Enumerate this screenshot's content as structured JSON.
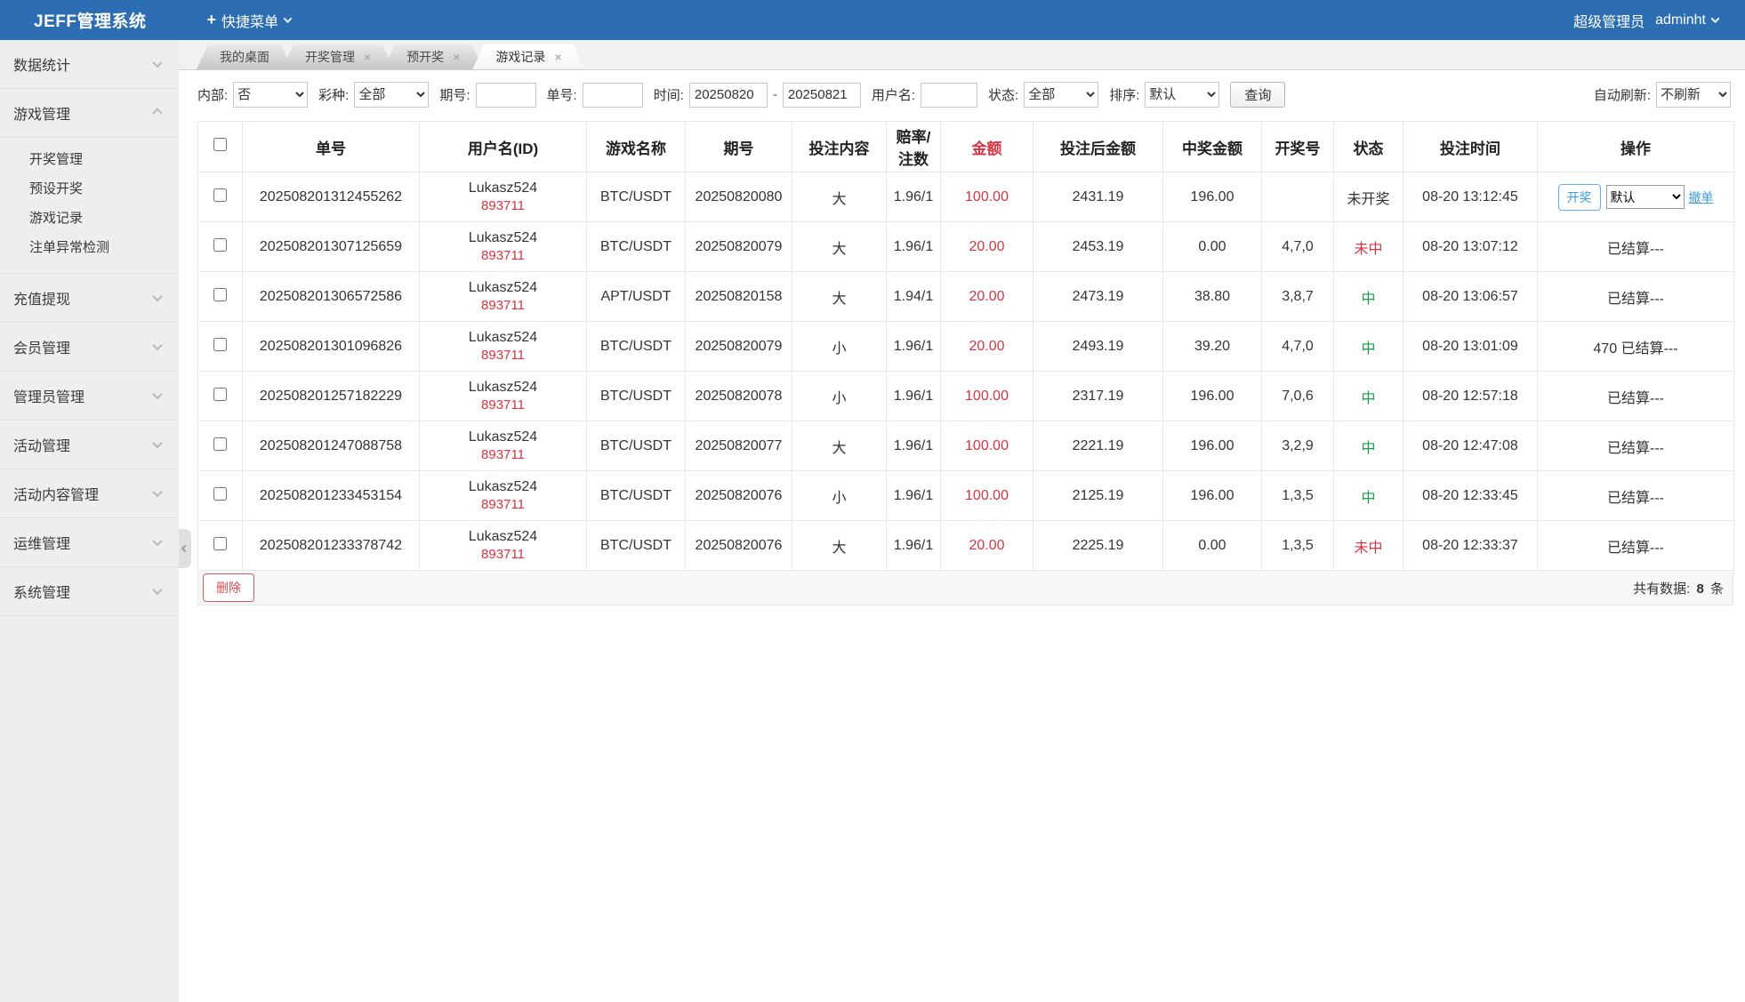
{
  "topbar": {
    "brand": "JEFF管理系统",
    "plus_icon": "+",
    "quick_menu": "快捷菜单",
    "role": "超级管理员",
    "username": "adminht"
  },
  "sidebar": {
    "groups": [
      {
        "label": "数据统计"
      },
      {
        "label": "游戏管理",
        "children": [
          "开奖管理",
          "预设开奖",
          "游戏记录",
          "注单异常检测"
        ]
      },
      {
        "label": "充值提现"
      },
      {
        "label": "会员管理"
      },
      {
        "label": "管理员管理"
      },
      {
        "label": "活动管理"
      },
      {
        "label": "活动内容管理"
      },
      {
        "label": "运维管理"
      },
      {
        "label": "系统管理"
      }
    ]
  },
  "tabs": [
    {
      "label": "我的桌面"
    },
    {
      "label": "开奖管理"
    },
    {
      "label": "预开奖"
    },
    {
      "label": "游戏记录"
    }
  ],
  "filters": {
    "internal_label": "内部:",
    "internal_value": "否",
    "lottery_label": "彩种:",
    "lottery_value": "全部",
    "issue_label": "期号:",
    "issue_value": "",
    "order_label": "单号:",
    "order_value": "",
    "time_label": "时间:",
    "time_from": "20250820",
    "time_separator": "-",
    "time_to": "20250821",
    "username_label": "用户名:",
    "username_value": "",
    "status_label": "状态:",
    "status_value": "全部",
    "sort_label": "排序:",
    "sort_value": "默认",
    "search_button": "查询",
    "auto_refresh_label": "自动刷新:",
    "auto_refresh_value": "不刷新"
  },
  "table": {
    "headers": [
      "单号",
      "用户名(ID)",
      "游戏名称",
      "期号",
      "投注内容",
      "赔率/注数",
      "金额",
      "投注后金额",
      "中奖金额",
      "开奖号",
      "状态",
      "投注时间",
      "操作"
    ],
    "rows": [
      {
        "no": "202508201312455262",
        "user": "Lukasz524",
        "uid": "893711",
        "game": "BTC/USDT",
        "issue": "20250820080",
        "bet": "大",
        "odds": "1.96/1",
        "amount": "100.00",
        "after": "2431.19",
        "win": "196.00",
        "draw": "",
        "status": "未开奖",
        "status_type": "pending",
        "time": "08-20 13:12:45",
        "controls": true,
        "action_text": ""
      },
      {
        "no": "202508201307125659",
        "user": "Lukasz524",
        "uid": "893711",
        "game": "BTC/USDT",
        "issue": "20250820079",
        "bet": "大",
        "odds": "1.96/1",
        "amount": "20.00",
        "after": "2453.19",
        "win": "0.00",
        "draw": "4,7,0",
        "status": "未中",
        "status_type": "lose",
        "time": "08-20 13:07:12",
        "controls": false,
        "action_text": "已结算---"
      },
      {
        "no": "202508201306572586",
        "user": "Lukasz524",
        "uid": "893711",
        "game": "APT/USDT",
        "issue": "20250820158",
        "bet": "大",
        "odds": "1.94/1",
        "amount": "20.00",
        "after": "2473.19",
        "win": "38.80",
        "draw": "3,8,7",
        "status": "中",
        "status_type": "win",
        "time": "08-20 13:06:57",
        "controls": false,
        "action_text": "已结算---"
      },
      {
        "no": "202508201301096826",
        "user": "Lukasz524",
        "uid": "893711",
        "game": "BTC/USDT",
        "issue": "20250820079",
        "bet": "小",
        "odds": "1.96/1",
        "amount": "20.00",
        "after": "2493.19",
        "win": "39.20",
        "draw": "4,7,0",
        "status": "中",
        "status_type": "win",
        "time": "08-20 13:01:09",
        "controls": false,
        "action_text": "470 已结算---"
      },
      {
        "no": "202508201257182229",
        "user": "Lukasz524",
        "uid": "893711",
        "game": "BTC/USDT",
        "issue": "20250820078",
        "bet": "小",
        "odds": "1.96/1",
        "amount": "100.00",
        "after": "2317.19",
        "win": "196.00",
        "draw": "7,0,6",
        "status": "中",
        "status_type": "win",
        "time": "08-20 12:57:18",
        "controls": false,
        "action_text": "已结算---"
      },
      {
        "no": "202508201247088758",
        "user": "Lukasz524",
        "uid": "893711",
        "game": "BTC/USDT",
        "issue": "20250820077",
        "bet": "大",
        "odds": "1.96/1",
        "amount": "100.00",
        "after": "2221.19",
        "win": "196.00",
        "draw": "3,2,9",
        "status": "中",
        "status_type": "win",
        "time": "08-20 12:47:08",
        "controls": false,
        "action_text": "已结算---"
      },
      {
        "no": "202508201233453154",
        "user": "Lukasz524",
        "uid": "893711",
        "game": "BTC/USDT",
        "issue": "20250820076",
        "bet": "小",
        "odds": "1.96/1",
        "amount": "100.00",
        "after": "2125.19",
        "win": "196.00",
        "draw": "1,3,5",
        "status": "中",
        "status_type": "win",
        "time": "08-20 12:33:45",
        "controls": false,
        "action_text": "已结算---"
      },
      {
        "no": "202508201233378742",
        "user": "Lukasz524",
        "uid": "893711",
        "game": "BTC/USDT",
        "issue": "20250820076",
        "bet": "大",
        "odds": "1.96/1",
        "amount": "20.00",
        "after": "2225.19",
        "win": "0.00",
        "draw": "1,3,5",
        "status": "未中",
        "status_type": "lose",
        "time": "08-20 12:33:37",
        "controls": false,
        "action_text": "已结算---"
      }
    ]
  },
  "row_actions": {
    "draw": "开奖",
    "mode": "默认",
    "cancel": "撤单"
  },
  "footer": {
    "delete": "删除",
    "total_prefix": "共有数据:",
    "count": "8",
    "unit": "条"
  },
  "colors": {
    "topbar_blue": "#2d6db3",
    "accent_red": "#d9333f",
    "win_green": "#1a9d4b",
    "link_blue": "#3c9be8"
  }
}
